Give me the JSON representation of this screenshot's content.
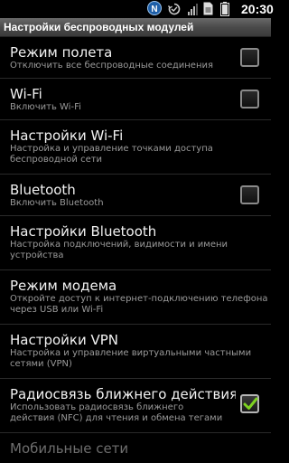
{
  "statusbar": {
    "time": "20:30",
    "icons": [
      "nfc-icon",
      "sync-icon",
      "signal-icon",
      "sim-icon",
      "battery-icon"
    ],
    "nfc_label": "N"
  },
  "title": "Настройки беспроводных модулей",
  "items": [
    {
      "title": "Режим полета",
      "subtitle": "Отключить все беспроводные соединения",
      "checkbox": true,
      "checked": false
    },
    {
      "title": "Wi-Fi",
      "subtitle": "Включить Wi-Fi",
      "checkbox": true,
      "checked": false
    },
    {
      "title": "Настройки Wi-Fi",
      "subtitle": "Настройка и управление точками доступа беспроводной сети",
      "checkbox": false
    },
    {
      "title": "Bluetooth",
      "subtitle": "Включить Bluetooth",
      "checkbox": true,
      "checked": false
    },
    {
      "title": "Настройки Bluetooth",
      "subtitle": "Настройка подключений, видимости и имени устройства",
      "checkbox": false
    },
    {
      "title": "Режим модема",
      "subtitle": "Откройте доступ к интернет-подключению телефона через USB или Wi-Fi",
      "checkbox": false
    },
    {
      "title": "Настройки VPN",
      "subtitle": "Настройка и управление виртуальными частными сетями (VPN)",
      "checkbox": false
    },
    {
      "title": "Радиосвязь ближнего действия (NFC)",
      "subtitle": "Использовать радиосвязь ближнего действия (NFC) для чтения и обмена тегами",
      "checkbox": true,
      "checked": true
    }
  ],
  "section_header": "Мобильные сети",
  "colors": {
    "check": "#7ed321",
    "background": "#000000",
    "subtitle": "#9a9a9a"
  }
}
